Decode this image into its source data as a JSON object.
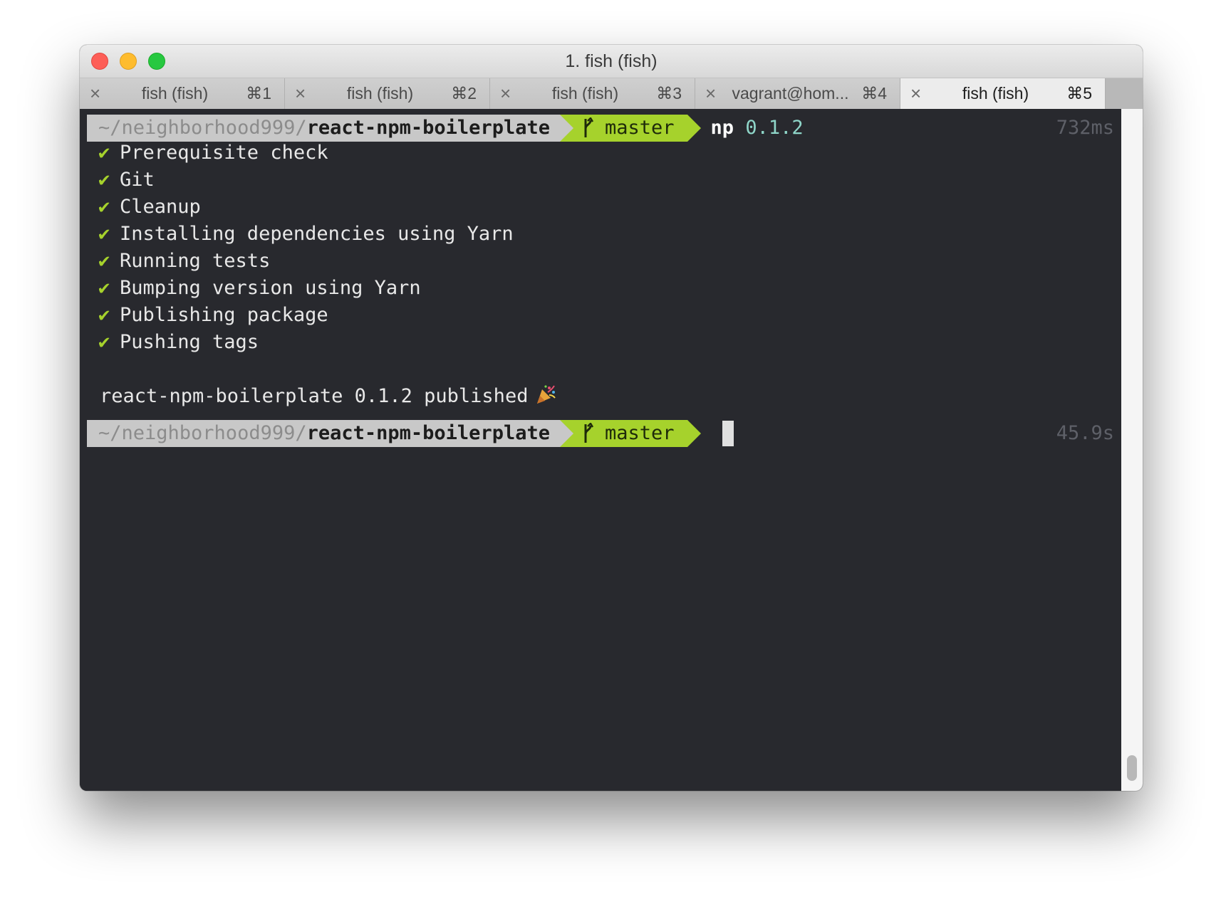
{
  "window": {
    "title": "1. fish (fish)",
    "tabs": [
      {
        "label": "fish (fish)",
        "shortcut": "⌘1",
        "active": false
      },
      {
        "label": "fish (fish)",
        "shortcut": "⌘2",
        "active": false
      },
      {
        "label": "fish (fish)",
        "shortcut": "⌘3",
        "active": false
      },
      {
        "label": "vagrant@hom...",
        "shortcut": "⌘4",
        "active": false
      },
      {
        "label": "fish (fish)",
        "shortcut": "⌘5",
        "active": true
      }
    ],
    "close_glyph": "×"
  },
  "terminal": {
    "prompt1": {
      "path_prefix": "~/neighborhood999/",
      "path_dir": "react-npm-boilerplate",
      "branch": "master",
      "command": "np",
      "command_arg": "0.1.2",
      "timing": "732ms"
    },
    "check_glyph": "✔",
    "steps": [
      "Prerequisite check",
      "Git",
      "Cleanup",
      "Installing dependencies using Yarn",
      "Running tests",
      "Bumping version using Yarn",
      "Publishing package",
      "Pushing tags"
    ],
    "result": "react-npm-boilerplate 0.1.2 published",
    "prompt2": {
      "path_prefix": "~/neighborhood999/",
      "path_dir": "react-npm-boilerplate",
      "branch": "master",
      "timing": "45.9s"
    }
  },
  "colors": {
    "terminal_bg": "#28292e",
    "path_bg": "#c8c8c8",
    "branch_bg": "#a6d22c",
    "check": "#a6d22c",
    "arg": "#8fd6c9"
  }
}
